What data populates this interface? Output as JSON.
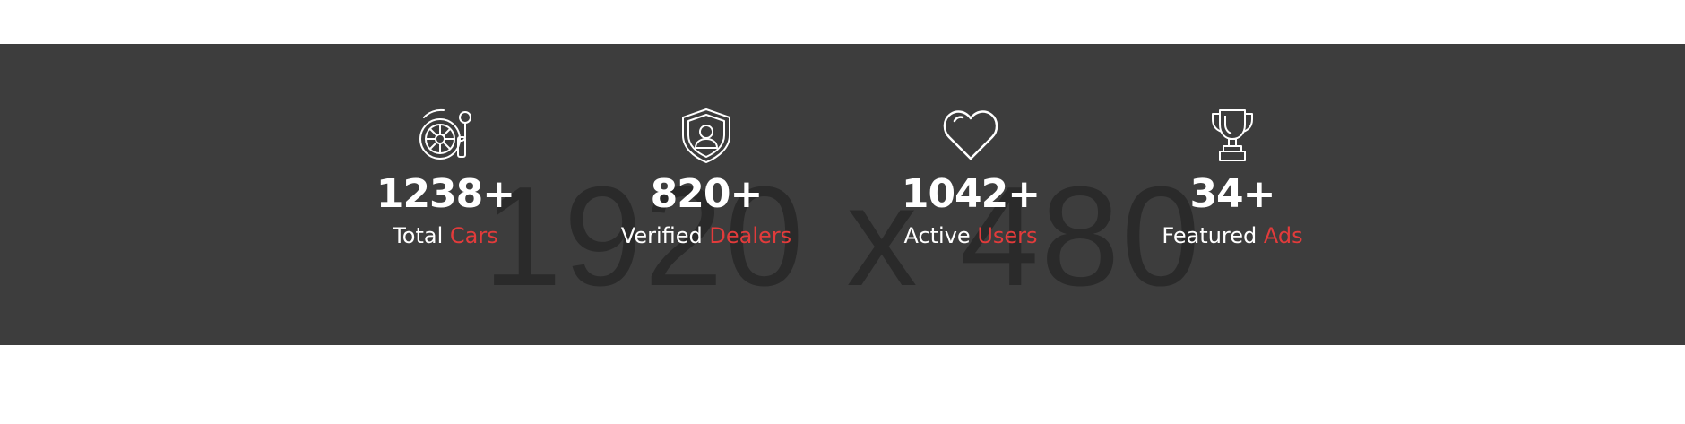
{
  "watermark": "1920 x 480",
  "stats": [
    {
      "icon": "car-wheel-icon",
      "value": "1238+",
      "label_main": "Total",
      "label_accent": "Cars"
    },
    {
      "icon": "verified-shield-icon",
      "value": "820+",
      "label_main": "Verified",
      "label_accent": "Dealers"
    },
    {
      "icon": "heart-icon",
      "value": "1042+",
      "label_main": "Active",
      "label_accent": "Users"
    },
    {
      "icon": "trophy-icon",
      "value": "34+",
      "label_main": "Featured",
      "label_accent": "Ads"
    }
  ],
  "colors": {
    "band": "#3d3d3d",
    "accent": "#e23b3b",
    "text": "#ffffff"
  }
}
